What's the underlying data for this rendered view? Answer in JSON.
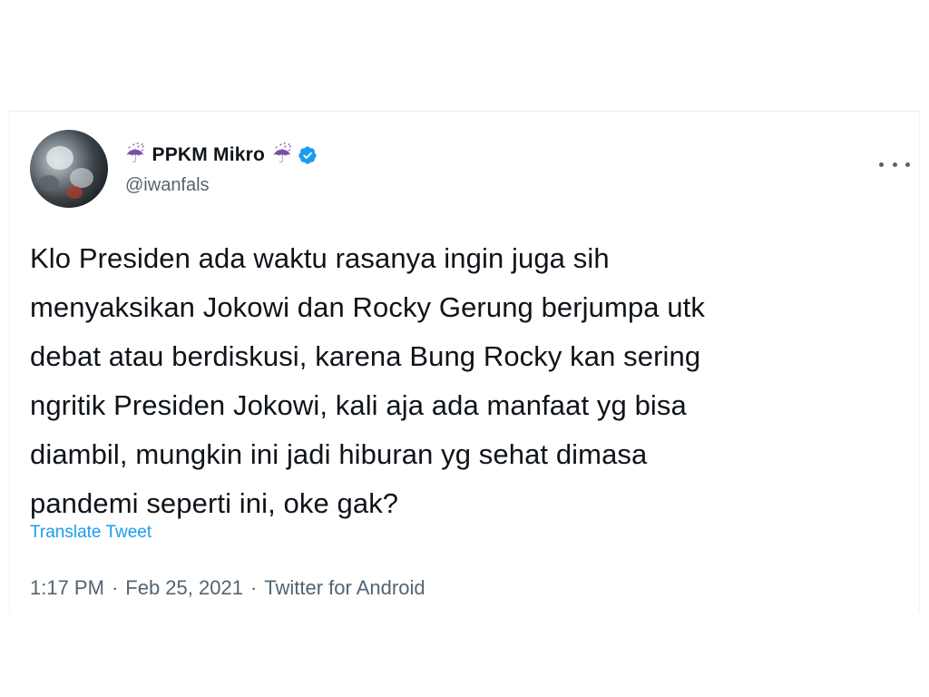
{
  "tweet": {
    "display_name": "PPKM Mikro",
    "name_emoji_left": "☔",
    "name_emoji_right": "☔",
    "handle": "@iwanfals",
    "text": "Klo Presiden ada waktu rasanya ingin juga sih\nmenyaksikan Jokowi dan Rocky Gerung berjumpa utk\ndebat atau berdiskusi, karena Bung Rocky kan sering\nngritik Presiden Jokowi, kali aja ada manfaat yg bisa\ndiambil, mungkin ini jadi hiburan yg sehat dimasa\npandemi seperti ini, oke gak?",
    "translate_label": "Translate Tweet",
    "time": "1:17 PM",
    "separator": "·",
    "date": "Feb 25, 2021",
    "source": "Twitter for Android"
  },
  "icons": {
    "verified": "verified-badge-icon",
    "more": "more-options-icon",
    "umbrella": "umbrella-rain-icon"
  },
  "colors": {
    "accent": "#1d9bf0",
    "text_primary": "#0f1419",
    "text_secondary": "#536471",
    "umbrella": "#7b4fa6"
  }
}
